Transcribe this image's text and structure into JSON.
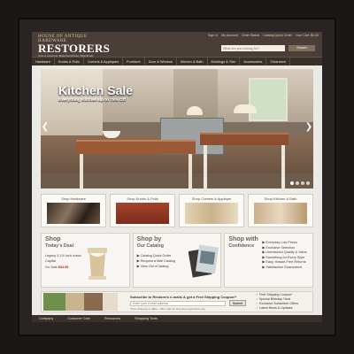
{
  "brand": {
    "line1": "HOUSE OF ANTIQUE HARDWARE",
    "name": "RESTORERS",
    "tagline": "Your Home Restoration Partner"
  },
  "top_links": [
    "Sign In",
    "My Account",
    "Order Status",
    "Catalog Quick Order",
    "Your Cart: $0.00"
  ],
  "search": {
    "placeholder": "What are you looking for?",
    "button": "Search"
  },
  "nav": [
    "Hardware",
    "Knobs & Pulls",
    "Corbels & Appliques",
    "Furniture",
    "Door & Window",
    "Kitchen & Bath",
    "Moldings & Trim",
    "Accessories",
    "Clearance"
  ],
  "hero": {
    "title": "Kitchen Sale",
    "subtitle": "Everything Kitchen up to 75% Off"
  },
  "categories": [
    {
      "label": "Shop Hardware"
    },
    {
      "label": "Shop Knobs & Pulls"
    },
    {
      "label": "Shop Corbels & Applique"
    },
    {
      "label": "Shop Kitchen & Bath"
    }
  ],
  "deal": {
    "h1": "Shop",
    "h2": "Today's Deal",
    "line1": "Legacy 3 1/4 Inch Iconic",
    "line2": "Capital",
    "sale_prefix": "On Sale",
    "price": "$32.99"
  },
  "catalog": {
    "h1": "Shop by",
    "h2": "Our Catalog",
    "links": [
      "Catalog Quick Order",
      "Request a Mail Catalog",
      "View Our eCatalog"
    ]
  },
  "confidence": {
    "h1": "Shop with",
    "h2": "Confidence",
    "items": [
      "Everyday Low Prices",
      "Exclusive Selection",
      "Unmatched Quality & Value",
      "Something for Every Style",
      "Easy, Hassle-Free Returns",
      "Satisfaction Guaranteed"
    ]
  },
  "newsletter": {
    "question": "Subscribe to Restorers e-mails & get a Free Shipping Coupon!*",
    "placeholder": "Enter your e-mail address",
    "button": "Submit",
    "fine_print": "*Free Shipping on $99+. Offer valid for first-time registrants only.",
    "benefits": [
      "Free Shipping Coupon*",
      "Special Birthday Treat",
      "Exclusive Subscriber Offers",
      "Latest News & Updates"
    ]
  },
  "footer": [
    "Company",
    "Customer Care",
    "Resources",
    "Shopping Tools"
  ],
  "colors": {
    "header": "#4a3f38",
    "nav": "#3a302a",
    "price": "#b2261d",
    "frame": "#1b1717"
  }
}
